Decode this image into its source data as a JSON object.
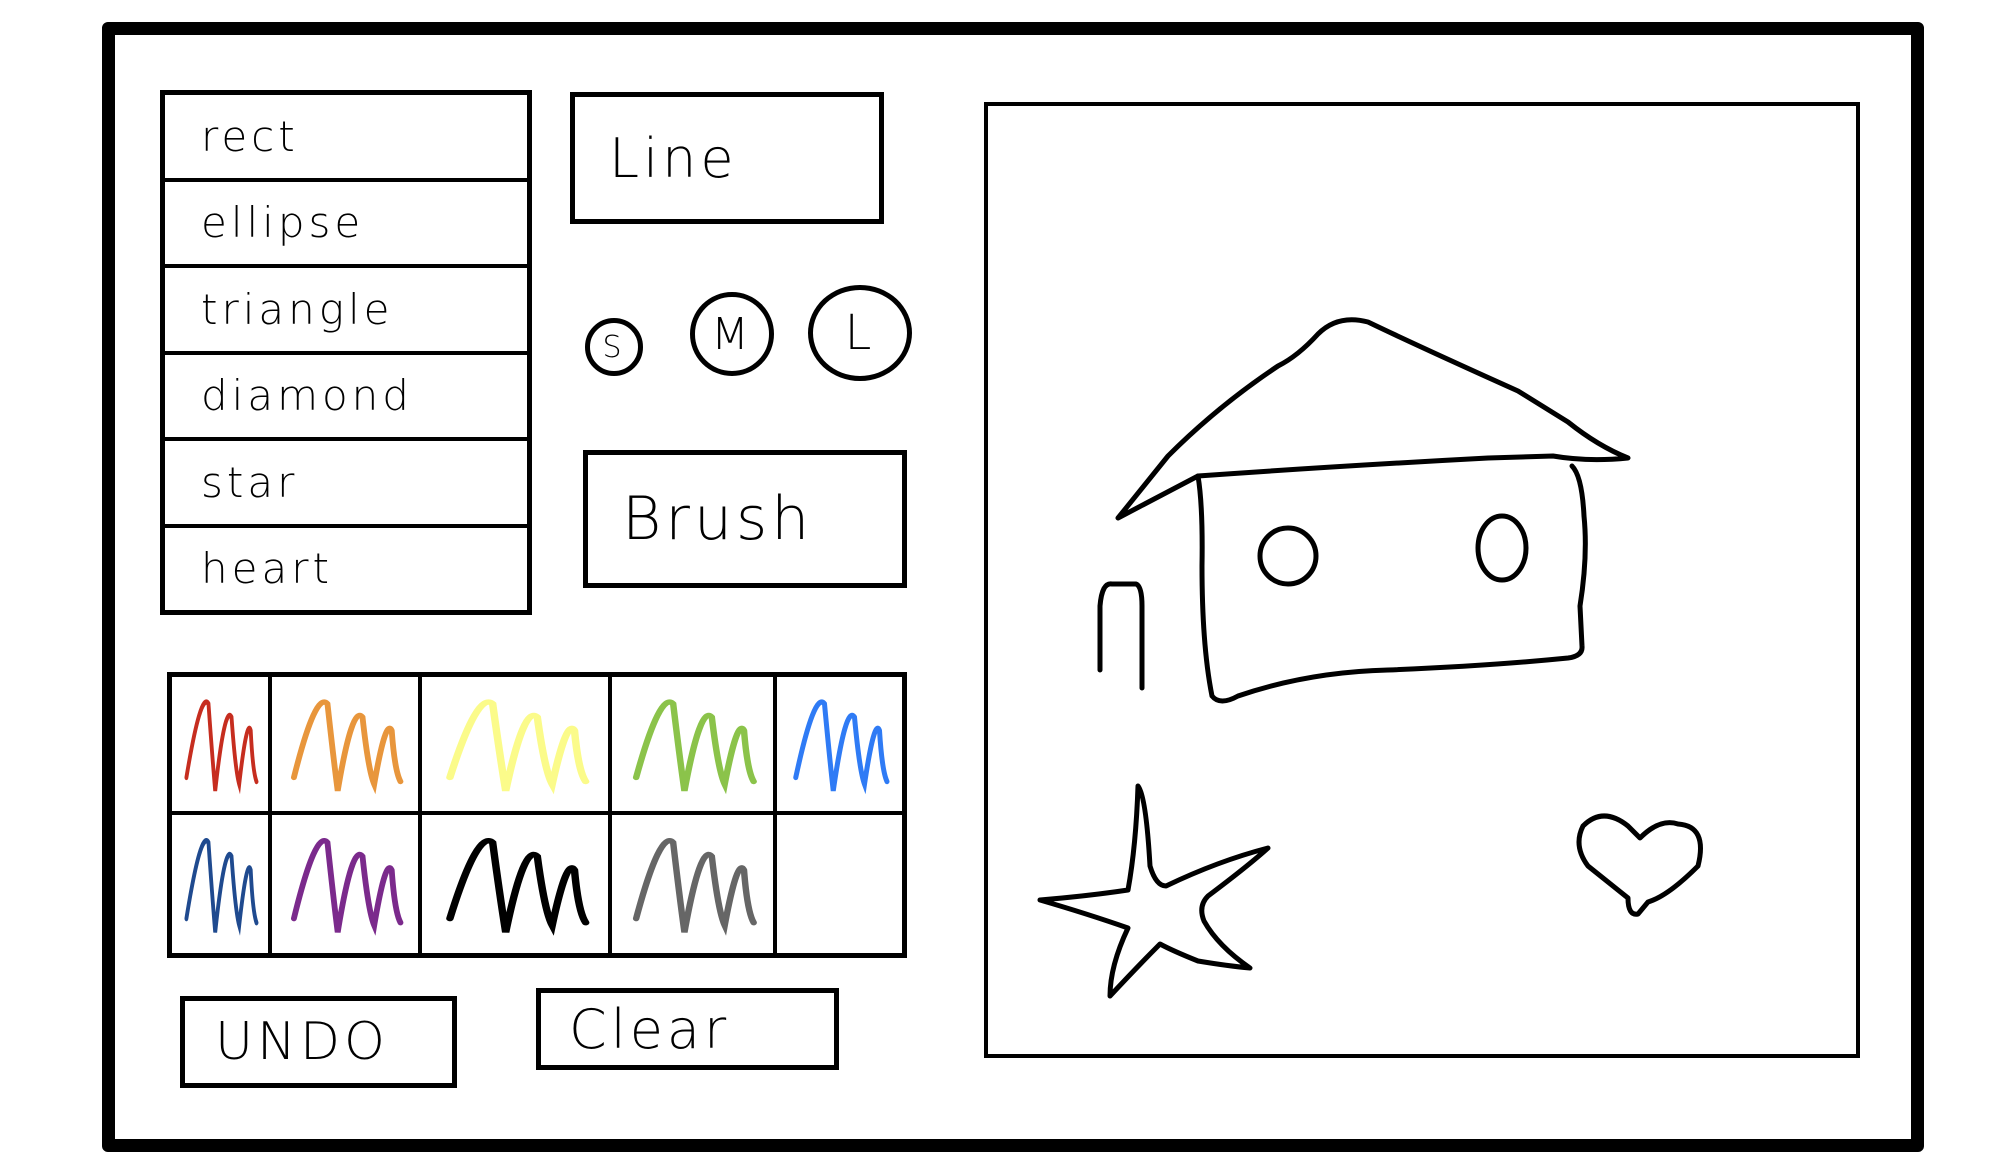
{
  "shapes": [
    "rect",
    "ellipse",
    "triangle",
    "diamond",
    "star",
    "heart"
  ],
  "tools": {
    "line": "Line",
    "brush": "Brush"
  },
  "sizes": [
    "S",
    "M",
    "L"
  ],
  "palette": [
    {
      "name": "red",
      "color": "#c62d1f"
    },
    {
      "name": "orange",
      "color": "#e8963c"
    },
    {
      "name": "yellow",
      "color": "#fbfb8a"
    },
    {
      "name": "green",
      "color": "#8bc34a"
    },
    {
      "name": "blue",
      "color": "#2f7bf5"
    },
    {
      "name": "navy",
      "color": "#1f4a8f"
    },
    {
      "name": "purple",
      "color": "#7b2a8c"
    },
    {
      "name": "black",
      "color": "#000000"
    },
    {
      "name": "gray",
      "color": "#666666"
    },
    {
      "name": "empty",
      "color": "#ffffff"
    }
  ],
  "actions": {
    "undo": "UNDO",
    "clear": "Clear"
  }
}
